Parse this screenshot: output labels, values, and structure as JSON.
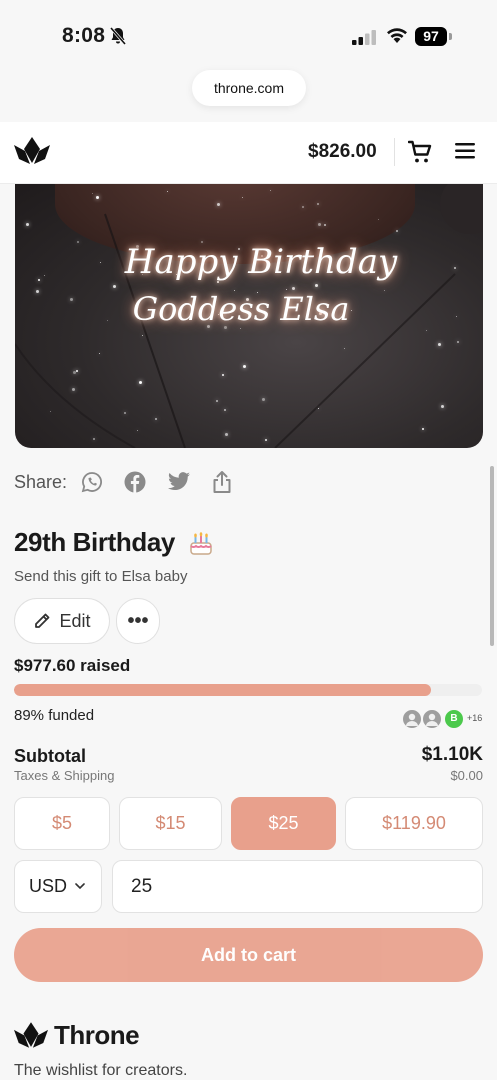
{
  "status": {
    "time": "8:08",
    "battery": "97"
  },
  "browser": {
    "url": "throne.com"
  },
  "header": {
    "balance": "$826.00"
  },
  "hero": {
    "line1": "Happy Birthday",
    "line2": "Goddess Elsa"
  },
  "share": {
    "label": "Share:"
  },
  "gift": {
    "title": "29th Birthday",
    "subtitle": "Send this gift to Elsa baby",
    "edit_label": "Edit",
    "more_label": "•••"
  },
  "funding": {
    "raised": "$977.60 raised",
    "funded_label": "89% funded",
    "progress": 0.89,
    "contributor_initial": "B",
    "more_contributors": "+16"
  },
  "subtotal": {
    "label": "Subtotal",
    "value": "$1.10K",
    "taxes_label": "Taxes & Shipping",
    "taxes_value": "$0.00"
  },
  "amounts": [
    {
      "label": "$5",
      "selected": false
    },
    {
      "label": "$15",
      "selected": false
    },
    {
      "label": "$25",
      "selected": true
    },
    {
      "label": "$119.90",
      "selected": false
    }
  ],
  "currency": {
    "selected": "USD"
  },
  "amount_input": {
    "value": "25"
  },
  "cart_button": {
    "label": "Add to cart"
  },
  "footer": {
    "brand": "Throne",
    "tagline": "The wishlist for creators."
  },
  "colors": {
    "accent": "#e8a08c",
    "accent_text": "#d48a74",
    "contributor_green": "#4cc94c"
  }
}
